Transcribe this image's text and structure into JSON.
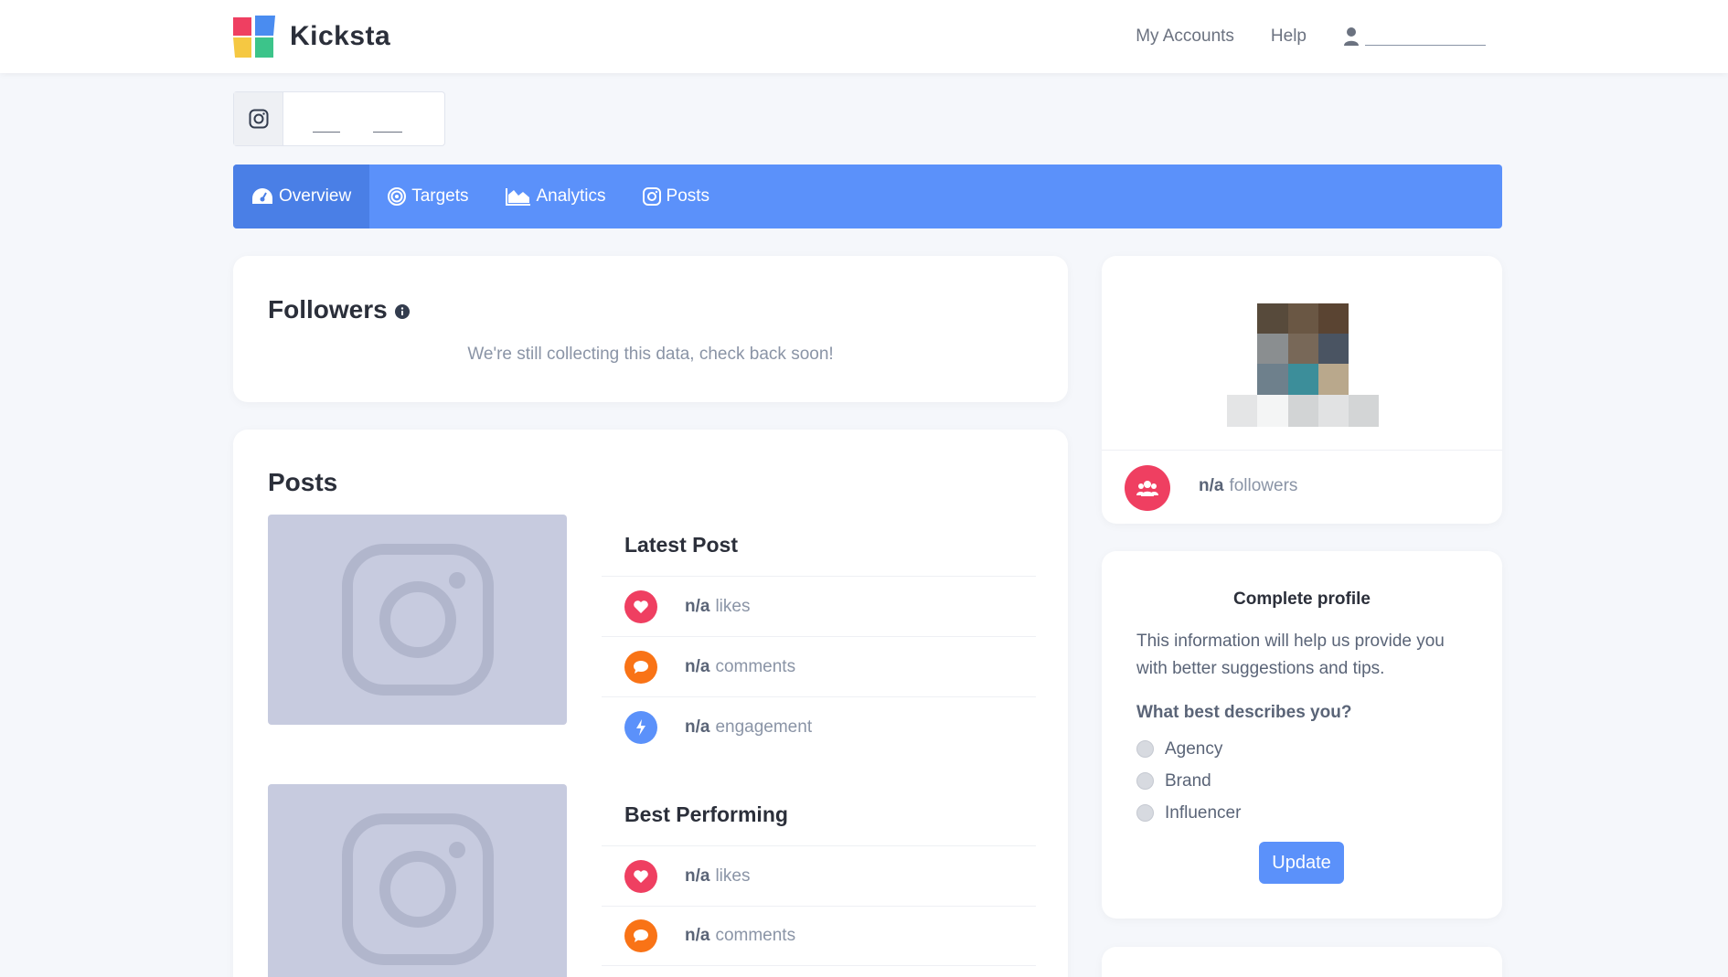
{
  "brand": {
    "name": "Kicksta"
  },
  "topnav": {
    "my_accounts": "My Accounts",
    "help": "Help"
  },
  "tabs": [
    {
      "label": "Overview",
      "icon": "gauge-icon"
    },
    {
      "label": "Targets",
      "icon": "target-icon"
    },
    {
      "label": "Analytics",
      "icon": "area-chart-icon"
    },
    {
      "label": "Posts",
      "icon": "instagram-icon"
    }
  ],
  "followers_card": {
    "title": "Followers",
    "message": "We're still collecting this data, check back soon!"
  },
  "posts_card": {
    "title": "Posts",
    "latest": {
      "heading": "Latest Post",
      "stats": [
        {
          "value": "n/a",
          "label": "likes"
        },
        {
          "value": "n/a",
          "label": "comments"
        },
        {
          "value": "n/a",
          "label": "engagement"
        }
      ]
    },
    "best": {
      "heading": "Best Performing",
      "stats": [
        {
          "value": "n/a",
          "label": "likes"
        },
        {
          "value": "n/a",
          "label": "comments"
        }
      ]
    }
  },
  "profile_card": {
    "followers_value": "n/a",
    "followers_label": "followers"
  },
  "complete_profile": {
    "title": "Complete profile",
    "description": "This information will help us provide you with better suggestions and tips.",
    "question": "What best describes you?",
    "options": [
      "Agency",
      "Brand",
      "Influencer"
    ],
    "button": "Update"
  },
  "colors": {
    "accent": "#5b91fa",
    "likes": "#ef3f61",
    "comments": "#f97316",
    "engagement": "#5b91fa"
  }
}
